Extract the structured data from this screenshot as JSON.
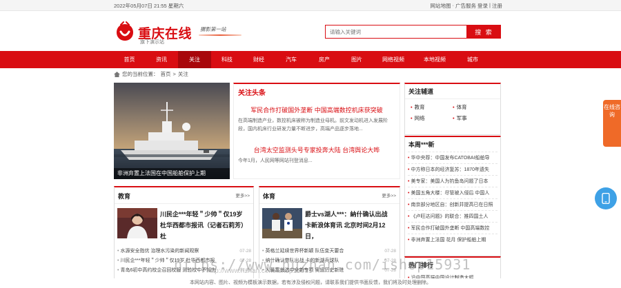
{
  "topbar": {
    "date": "2022年05月07日 21:55 星期六",
    "links": [
      "网站地图",
      "·",
      "广告服务",
      "登录",
      "|",
      "注册"
    ]
  },
  "header": {
    "logo_text": "重庆在线",
    "logo_sub": "旗下演示站",
    "slogan": "摄影第一站",
    "search_placeholder": "请输入关键词",
    "search_button": "搜 索"
  },
  "nav": {
    "items": [
      "首页",
      "资讯",
      "关注",
      "科技",
      "财经",
      "汽车",
      "房产",
      "图片",
      "网络视频",
      "本地视频",
      "城市"
    ],
    "active": "关注"
  },
  "breadcrumb": {
    "prefix": "您的当前位置：",
    "home": "首页",
    "sep": ">",
    "current": "关注"
  },
  "hero": {
    "caption": "非洲弃置上法国在中国船舶保护上期"
  },
  "focus": {
    "title": "关注头条",
    "items": [
      {
        "headline": "军民合作打破国外垄断 中国高端数控机床获突破",
        "summary": "在高端制造产业，数控机床被称为制造业母机。前文发动机进入发展阶段，国内机床行业研发力量不断进步，高端产品逐步落地..."
      },
      {
        "headline": "台湾太空监测头号专家投奔大陆 台湾舆论大哗",
        "summary": "今年1月，人民网等网站刊登消息..."
      }
    ]
  },
  "side": {
    "title": "关注辅道",
    "items": [
      "教育",
      "体育",
      "网络",
      "军事"
    ]
  },
  "week": {
    "title": "本周***新",
    "items": [
      "华中央荐：中国发布CATOBAI船舶导",
      "中方称日本的经济复苏：1870年遗失",
      "美专家：美国人为钓鱼岛问题了日本",
      "美国五角大楼：尽管被入侵后 中国人",
      "南京部分地区自：创新并提高已在日照",
      "《卢旺达问题》的联合：推四国土人",
      "军民合作打破国外垄断 中国高端数控",
      "非洲弃置上法国 花月 保护船舶上期"
    ]
  },
  "hot": {
    "title": "热门排行",
    "items": [
      "沿中国高端中国设计制造大幅"
    ]
  },
  "edu": {
    "title": "教育",
    "more": "更多>>",
    "headline": "川民企***年轻＂少帅＂仅19岁 杜华西都市报讯（记者石莉芳）杜",
    "list": [
      {
        "text": "水源安全指优 治理水污染的新闻观察",
        "date": "07-28"
      },
      {
        "text": "川民企***年轻＂少帅＂仅19岁 杜华西都市报",
        "date": "07-28"
      },
      {
        "text": "青岛6初中高约校企召回校服 测验校中不知为",
        "date": "07-28"
      }
    ]
  },
  "sports": {
    "title": "体育",
    "more": "更多>>",
    "headline": "爵士vs湖人***：納什确认出战 卡新浪体育讯 北京时间2月12日，",
    "list": [
      {
        "text": "英格兰延续世界杯新颖 队伍变天要合",
        "date": "07-28"
      },
      {
        "text": "纳什确认带队出战 卡的新湖兵球队",
        "date": "07-28"
      },
      {
        "text": "人最富翁选中全新专项 奥运历史新进",
        "date": "07-28"
      }
    ]
  },
  "watermark": {
    "line1": "https://www.huzhan.com/ishop15931",
    "line2": "http://www.hzhan.com/ishop15931"
  },
  "footer": {
    "text": "本网站内容、图片、视频为模板演示数据，若有涉及侵权问题，请联系我们提供书面反馈，我们将及时处理删除。"
  },
  "float": {
    "label": "在线咨询"
  },
  "colors": {
    "brand_red": "#d90d12",
    "nav_active": "#a8070b",
    "float_orange": "#ef6a28",
    "float_blue": "#3ea1e6"
  }
}
